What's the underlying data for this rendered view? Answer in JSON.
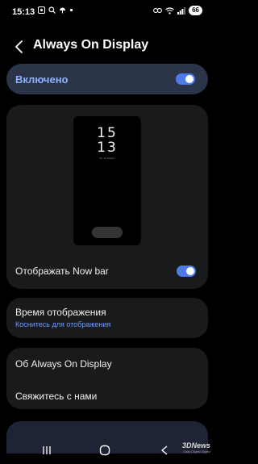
{
  "status_bar": {
    "time": "15:13",
    "battery": "66"
  },
  "header": {
    "title": "Always On Display"
  },
  "main_toggle": {
    "label": "Включено",
    "enabled": true
  },
  "preview": {
    "clock_hour": "15",
    "clock_min": "13",
    "date_text": "Пн, 16 апреля"
  },
  "now_bar": {
    "label": "Отображать Now bar",
    "enabled": true
  },
  "display_time": {
    "title": "Время отображения",
    "subtitle": "Коснитесь для отображения"
  },
  "info": {
    "about": "Об Always On Display",
    "contact": "Свяжитесь с нами"
  },
  "watermark": {
    "logo": "3DNews",
    "tagline": "Daily Digital Digest"
  },
  "colors": {
    "accent": "#4f7be8",
    "accent_text": "#8fb0ff",
    "link": "#6f9bff",
    "card": "#191a1c",
    "highlight_card": "#2c3449"
  }
}
